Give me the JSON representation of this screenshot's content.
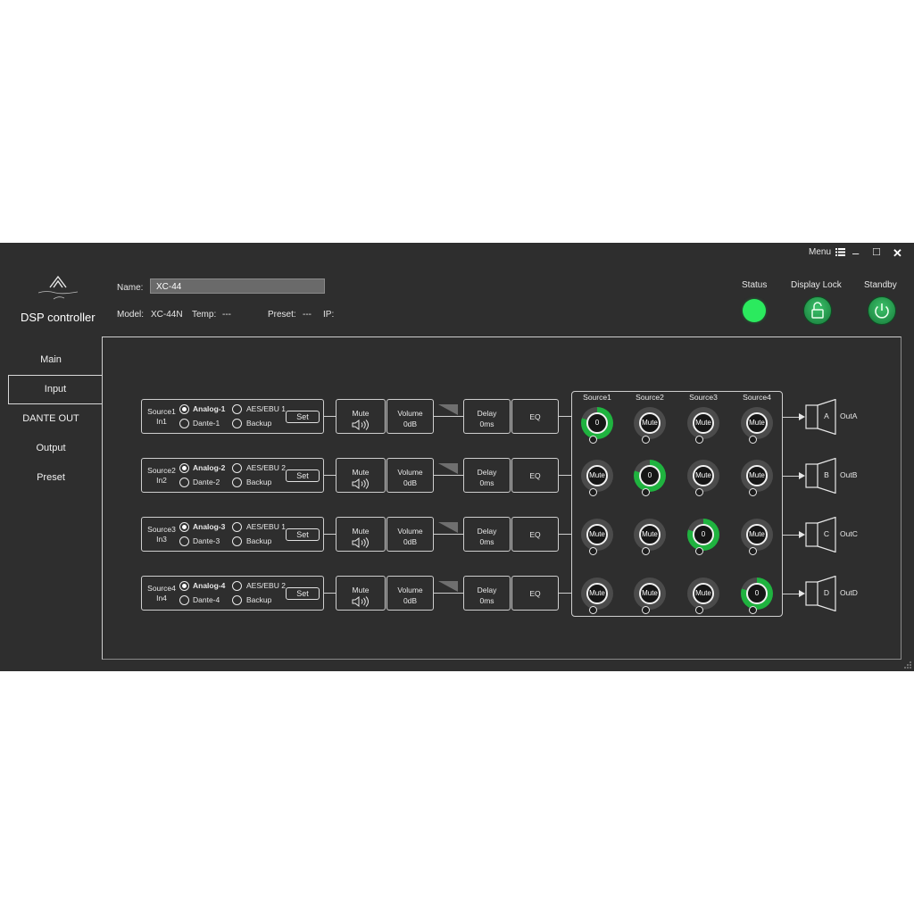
{
  "titlebar": {
    "menu_label": "Menu",
    "menu_icon": "list-icon",
    "minimize": "–",
    "maximize": "□",
    "close": "✕"
  },
  "app": {
    "logo_icon": "brand-logo",
    "title": "DSP controller"
  },
  "device": {
    "name_label": "Name:",
    "name_value": "XC-44",
    "model_label": "Model:",
    "model_value": "XC-44N",
    "temp_label": "Temp:",
    "temp_value": "---",
    "preset_label": "Preset:",
    "preset_value": "---",
    "ip_label": "IP:",
    "ip_value": ""
  },
  "indicators": {
    "status_label": "Status",
    "status_color": "#2bea5e",
    "display_lock_label": "Display Lock",
    "display_lock_icon": "unlock-icon",
    "standby_label": "Standby",
    "standby_icon": "power-icon"
  },
  "nav": [
    "Main",
    "Input",
    "DANTE OUT",
    "Output",
    "Preset"
  ],
  "nav_active": "Input",
  "channels": [
    {
      "source": "Source1",
      "input": "In1",
      "analog": "Analog-1",
      "dante": "Dante-1",
      "aes": "AES/EBU 1",
      "backup": "Backup",
      "set": "Set",
      "mute": "Mute",
      "volume_label": "Volume",
      "volume": "0dB",
      "delay_label": "Delay",
      "delay": "0ms",
      "eq": "EQ"
    },
    {
      "source": "Source2",
      "input": "In2",
      "analog": "Analog-2",
      "dante": "Dante-2",
      "aes": "AES/EBU 2",
      "backup": "Backup",
      "set": "Set",
      "mute": "Mute",
      "volume_label": "Volume",
      "volume": "0dB",
      "delay_label": "Delay",
      "delay": "0ms",
      "eq": "EQ"
    },
    {
      "source": "Source3",
      "input": "In3",
      "analog": "Analog-3",
      "dante": "Dante-3",
      "aes": "AES/EBU 1",
      "backup": "Backup",
      "set": "Set",
      "mute": "Mute",
      "volume_label": "Volume",
      "volume": "0dB",
      "delay_label": "Delay",
      "delay": "0ms",
      "eq": "EQ"
    },
    {
      "source": "Source4",
      "input": "In4",
      "analog": "Analog-4",
      "dante": "Dante-4",
      "aes": "AES/EBU 2",
      "backup": "Backup",
      "set": "Set",
      "mute": "Mute",
      "volume_label": "Volume",
      "volume": "0dB",
      "delay_label": "Delay",
      "delay": "0ms",
      "eq": "EQ"
    }
  ],
  "matrix": {
    "columns": [
      "Source1",
      "Source2",
      "Source3",
      "Source4"
    ],
    "rows": [
      [
        "0",
        "Mute",
        "Mute",
        "Mute"
      ],
      [
        "Mute",
        "0",
        "Mute",
        "Mute"
      ],
      [
        "Mute",
        "Mute",
        "0",
        "Mute"
      ],
      [
        "Mute",
        "Mute",
        "Mute",
        "0"
      ]
    ],
    "active_color": "#1fb33f"
  },
  "outputs": [
    {
      "letter": "A",
      "label": "OutA"
    },
    {
      "letter": "B",
      "label": "OutB"
    },
    {
      "letter": "C",
      "label": "OutC"
    },
    {
      "letter": "D",
      "label": "OutD"
    }
  ]
}
